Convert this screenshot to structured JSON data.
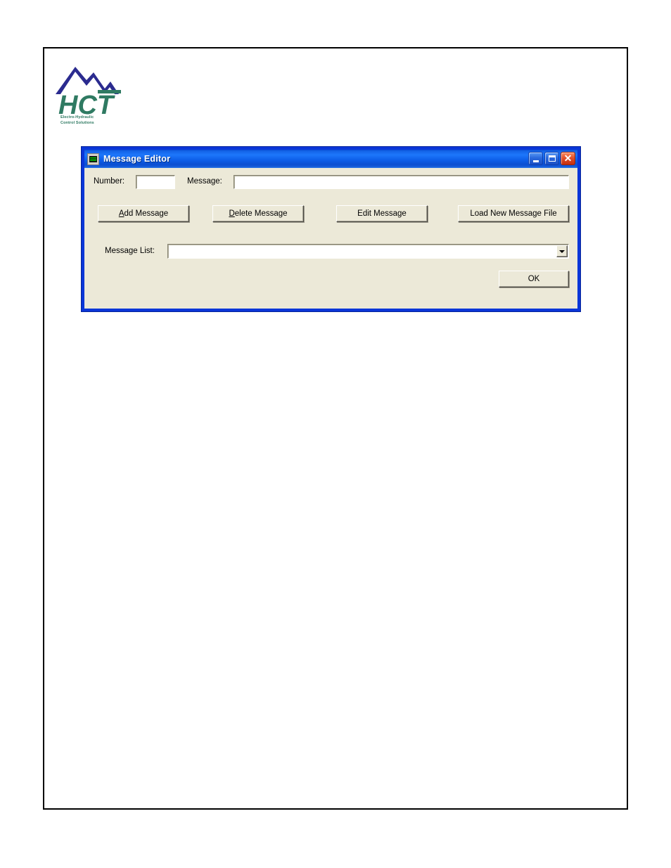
{
  "logo": {
    "wordmark": "HCT",
    "tagline_line1": "Electro-Hydraulic",
    "tagline_line2": "Control Solutions",
    "mountain_color": "#2b2b8f",
    "wordmark_color": "#2f7a62",
    "accent_color": "#2f7a62"
  },
  "dialog": {
    "title": "Message Editor",
    "icon": "vb-form-icon",
    "frame_color": "#0a36d8",
    "client_color": "#ece9d8",
    "titlebar_color": "#1d77fb",
    "window_buttons": [
      {
        "name": "minimize",
        "glyph": "_"
      },
      {
        "name": "maximize",
        "glyph": "□"
      },
      {
        "name": "close",
        "glyph": "✕"
      }
    ],
    "fields": {
      "number_label": "Number:",
      "number_value": "",
      "number_placeholder": "",
      "message_label": "Message:",
      "message_value": "",
      "message_placeholder": "",
      "list_label": "Message List:",
      "list_value": "",
      "list_options": []
    },
    "buttons": {
      "add": {
        "pre": "",
        "accel": "A",
        "post": "dd Message",
        "full": "Add Message"
      },
      "delete": {
        "pre": "",
        "accel": "D",
        "post": "elete Message",
        "full": "Delete Message"
      },
      "edit": {
        "full": "Edit Message"
      },
      "load": {
        "full": "Load New Message File"
      },
      "ok": {
        "full": "OK"
      }
    }
  }
}
